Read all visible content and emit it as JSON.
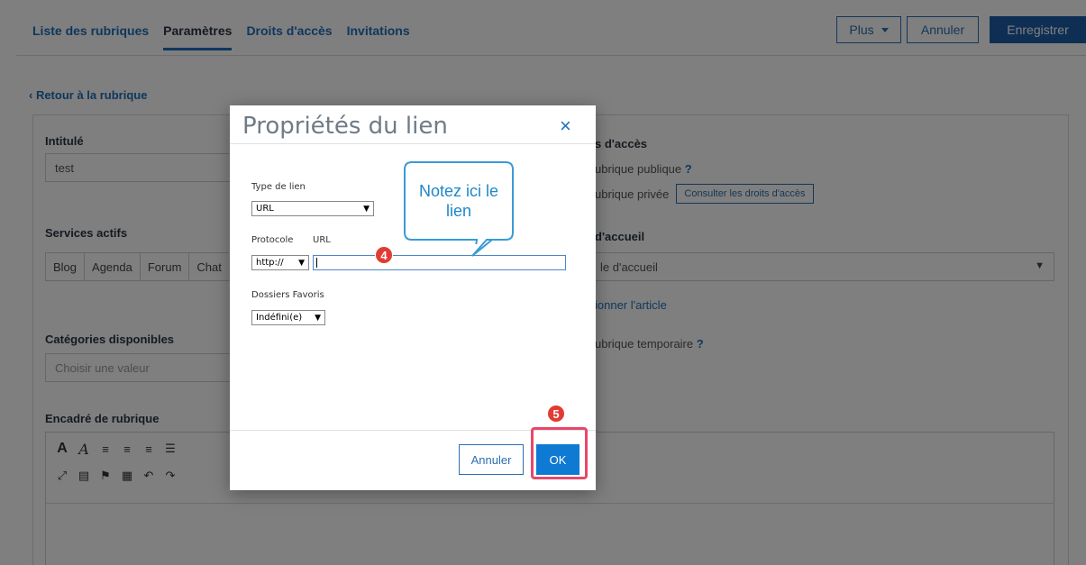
{
  "nav": {
    "tabs": [
      "Liste des rubriques",
      "Paramètres",
      "Droits d'accès",
      "Invitations"
    ],
    "active_tab": "Paramètres",
    "plus_label": "Plus",
    "cancel_label": "Annuler",
    "save_label": "Enregistrer"
  },
  "page": {
    "back_link": "‹ Retour à la rubrique",
    "intitule_label": "Intitulé",
    "intitule_value": "test",
    "services_label": "Services actifs",
    "services": [
      "Blog",
      "Agenda",
      "Forum",
      "Chat"
    ],
    "categories_label": "Catégories disponibles",
    "categories_placeholder": "Choisir une valeur",
    "encadre_label": "Encadré de rubrique",
    "access_title": "s d'accès",
    "public_text": "ubrique publique",
    "prive_text": "ubrique privée",
    "consult_btn": "Consulter les droits d'accès",
    "accueil_label": "d'accueil",
    "accueil_value": "le d'accueil",
    "article_link": "ionner l'article",
    "temp_text": "ubrique temporaire",
    "help_mark": "?"
  },
  "modal": {
    "title": "Propriétés du lien",
    "close": "×",
    "type_label": "Type de lien",
    "type_value": "URL",
    "protocol_label": "Protocole",
    "url_label": "URL",
    "protocol_value": "http://",
    "url_value": "",
    "favorites_label": "Dossiers Favoris",
    "favorites_value": "Indéfini(e)",
    "cancel_label": "Annuler",
    "ok_label": "OK"
  },
  "annotations": {
    "callout_text": "Notez ici le lien",
    "badge_4": "4",
    "badge_5": "5"
  },
  "colors": {
    "brand_blue": "#1c5fa6",
    "ok_blue": "#0e7ad4",
    "highlight": "#e8476a",
    "badge_red": "#e23b33",
    "callout_blue": "#1e88c8"
  }
}
